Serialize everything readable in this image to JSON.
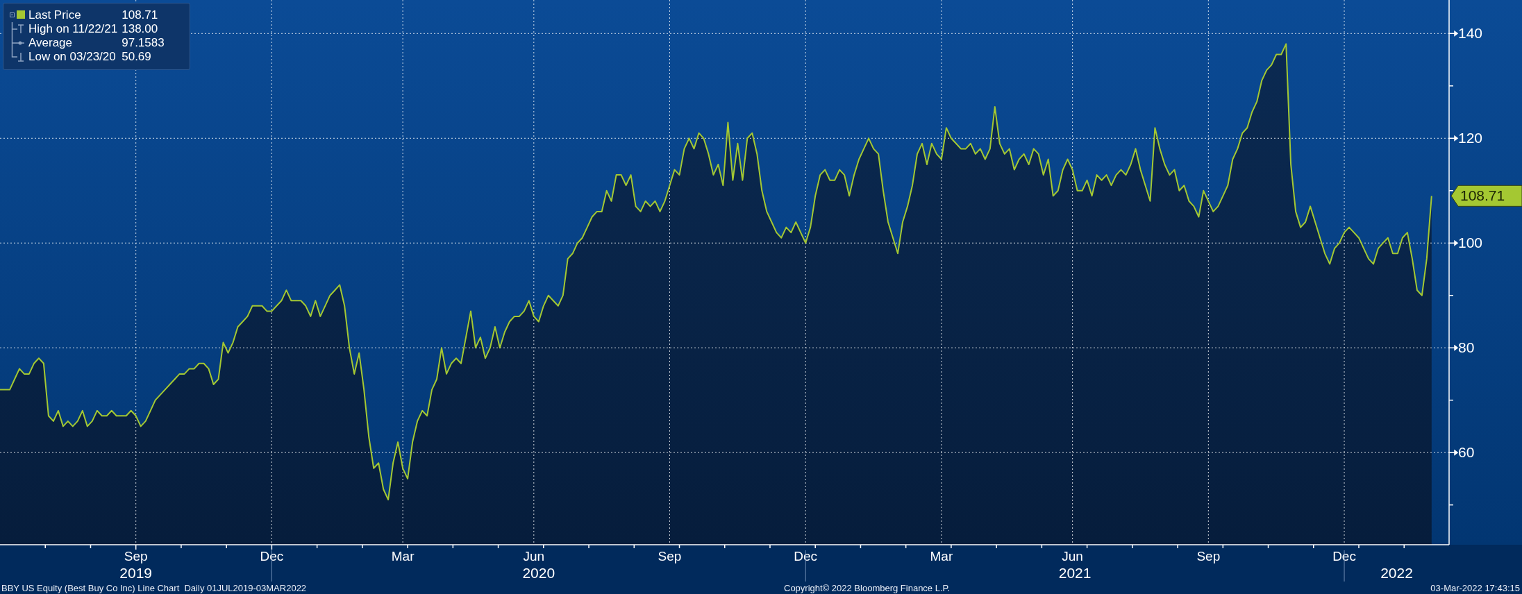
{
  "legend": {
    "items": [
      {
        "kind": "series",
        "value": "108.71"
      },
      {
        "kind": "high",
        "label": "High on 11/22/21",
        "value": "138.00"
      },
      {
        "kind": "average",
        "label": "Average",
        "value": "97.1583"
      },
      {
        "kind": "low",
        "label": "Low on 03/23/20",
        "value": "50.69"
      }
    ]
  },
  "chart": {
    "last_price_tag": "108.71",
    "year_axis": [
      "2019",
      "2020",
      "2021",
      "2022"
    ],
    "chart_data": {
      "type": "area",
      "grid": true,
      "ylim": [
        42.4,
        146.4
      ],
      "yticks": [
        60,
        80,
        100,
        120,
        140
      ],
      "categories": [
        null,
        null,
        null,
        null,
        null,
        null,
        null,
        null,
        null,
        null,
        null,
        null,
        null,
        null,
        null,
        null,
        null,
        null,
        null,
        null,
        null,
        null,
        null,
        null,
        null,
        null,
        null,
        null,
        "Sep",
        null,
        null,
        null,
        null,
        null,
        null,
        null,
        null,
        null,
        null,
        null,
        null,
        null,
        null,
        null,
        null,
        null,
        null,
        null,
        null,
        null,
        null,
        null,
        null,
        null,
        null,
        null,
        "Dec",
        null,
        null,
        null,
        null,
        null,
        null,
        null,
        null,
        null,
        null,
        null,
        null,
        null,
        null,
        null,
        null,
        null,
        null,
        null,
        null,
        null,
        null,
        null,
        null,
        null,
        null,
        "Mar",
        null,
        null,
        null,
        null,
        null,
        null,
        null,
        null,
        null,
        null,
        null,
        null,
        null,
        null,
        null,
        null,
        null,
        null,
        null,
        null,
        null,
        null,
        null,
        null,
        null,
        null,
        "Jun",
        null,
        null,
        null,
        null,
        null,
        null,
        null,
        null,
        null,
        null,
        null,
        null,
        null,
        null,
        null,
        null,
        null,
        null,
        null,
        null,
        null,
        null,
        null,
        null,
        null,
        null,
        null,
        "Sep",
        null,
        null,
        null,
        null,
        null,
        null,
        null,
        null,
        null,
        null,
        null,
        null,
        null,
        null,
        null,
        null,
        null,
        null,
        null,
        null,
        null,
        null,
        null,
        null,
        null,
        null,
        null,
        "Dec",
        null,
        null,
        null,
        null,
        null,
        null,
        null,
        null,
        null,
        null,
        null,
        null,
        null,
        null,
        null,
        null,
        null,
        null,
        null,
        null,
        null,
        null,
        null,
        null,
        null,
        null,
        null,
        "Mar",
        null,
        null,
        null,
        null,
        null,
        null,
        null,
        null,
        null,
        null,
        null,
        null,
        null,
        null,
        null,
        null,
        null,
        null,
        null,
        null,
        null,
        null,
        null,
        null,
        null,
        null,
        "Jun",
        null,
        null,
        null,
        null,
        null,
        null,
        null,
        null,
        null,
        null,
        null,
        null,
        null,
        null,
        null,
        null,
        null,
        null,
        null,
        null,
        null,
        null,
        null,
        null,
        null,
        null,
        null,
        "Sep",
        null,
        null,
        null,
        null,
        null,
        null,
        null,
        null,
        null,
        null,
        null,
        null,
        null,
        null,
        null,
        null,
        null,
        null,
        null,
        null,
        null,
        null,
        null,
        null,
        null,
        null,
        null,
        "Dec",
        null,
        null,
        null,
        null,
        null,
        null,
        null,
        null,
        null,
        null,
        null,
        null,
        null,
        null,
        null,
        null,
        null,
        null
      ],
      "series": [
        {
          "name": "Last Price",
          "color": "#a4c832",
          "values": [
            72,
            72,
            72,
            74,
            76,
            75,
            75,
            77,
            78,
            77,
            67,
            66,
            68,
            65,
            66,
            65,
            66,
            68,
            65,
            66,
            68,
            67,
            67,
            68,
            67,
            67,
            67,
            68,
            67,
            65,
            66,
            68,
            70,
            71,
            72,
            73,
            74,
            75,
            75,
            76,
            76,
            77,
            77,
            76,
            73,
            74,
            81,
            79,
            81,
            84,
            85,
            86,
            88,
            88,
            88,
            87,
            87,
            88,
            89,
            91,
            89,
            89,
            89,
            88,
            86,
            89,
            86,
            88,
            90,
            91,
            92,
            88,
            80,
            75,
            79,
            72,
            63,
            57,
            58,
            53,
            51,
            58,
            62,
            57,
            55,
            62,
            66,
            68,
            67,
            72,
            74,
            80,
            75,
            77,
            78,
            77,
            82,
            87,
            80,
            82,
            78,
            80,
            84,
            80,
            83,
            85,
            86,
            86,
            87,
            89,
            86,
            85,
            88,
            90,
            89,
            88,
            90,
            97,
            98,
            100,
            101,
            103,
            105,
            106,
            106,
            110,
            108,
            113,
            113,
            111,
            113,
            107,
            106,
            108,
            107,
            108,
            106,
            108,
            111,
            114,
            113,
            118,
            120,
            118,
            121,
            120,
            117,
            113,
            115,
            111,
            123,
            112,
            119,
            112,
            120,
            121,
            117,
            110,
            106,
            104,
            102,
            101,
            103,
            102,
            104,
            102,
            100,
            103,
            109,
            113,
            114,
            112,
            112,
            114,
            113,
            109,
            113,
            116,
            118,
            120,
            118,
            117,
            110,
            104,
            101,
            98,
            104,
            107,
            111,
            117,
            119,
            115,
            119,
            117,
            116,
            122,
            120,
            119,
            118,
            118,
            119,
            117,
            118,
            116,
            118,
            126,
            119,
            117,
            118,
            114,
            116,
            117,
            115,
            118,
            117,
            113,
            116,
            109,
            110,
            114,
            116,
            114,
            110,
            110,
            112,
            109,
            113,
            112,
            113,
            111,
            113,
            114,
            113,
            115,
            118,
            114,
            111,
            108,
            122,
            118,
            115,
            113,
            114,
            110,
            111,
            108,
            107,
            105,
            110,
            108,
            106,
            107,
            109,
            111,
            116,
            118,
            121,
            122,
            125,
            127,
            131,
            133,
            134,
            136,
            136,
            138,
            115,
            106,
            103,
            104,
            107,
            104,
            101,
            98,
            96,
            99,
            100,
            102,
            103,
            102,
            101,
            99,
            97,
            96,
            99,
            100,
            101,
            98,
            98,
            101,
            102,
            97,
            91,
            90,
            97,
            109
          ]
        }
      ]
    }
  },
  "footer": {
    "description": "BBY US Equity (Best Buy Co Inc) Line Chart  Daily 01JUL2019-03MAR2022",
    "copyright": "Copyright© 2022 Bloomberg Finance L.P.",
    "timestamp": "03-Mar-2022 17:43:15"
  }
}
